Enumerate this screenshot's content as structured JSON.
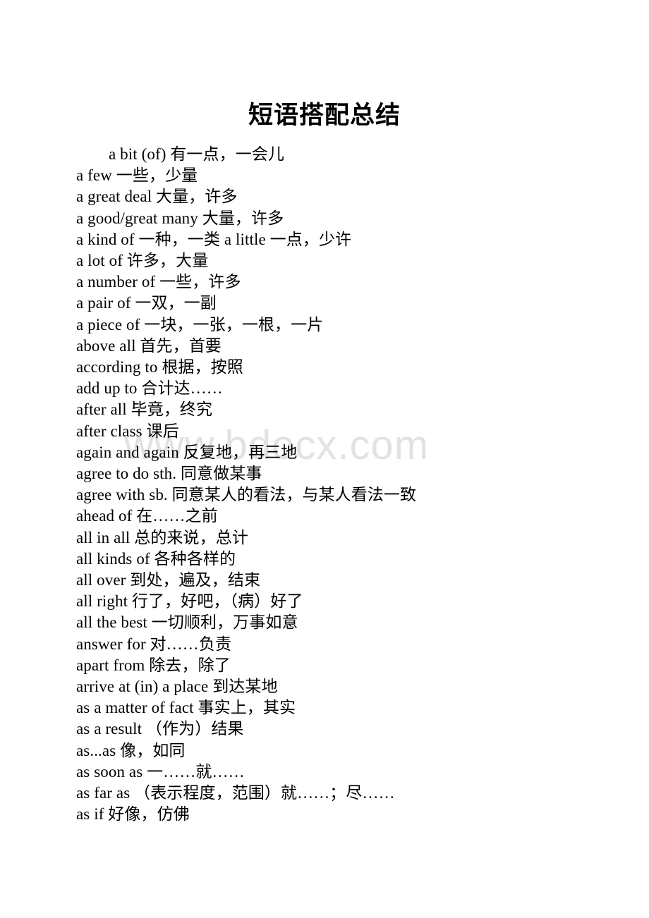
{
  "document": {
    "title": "短语搭配总结",
    "watermark": "www.bdocx.com",
    "lines": [
      {
        "text": "a bit (of) 有一点，一会儿",
        "indented": true
      },
      {
        "text": "a few 一些，少量",
        "indented": false
      },
      {
        "text": "a great deal 大量，许多",
        "indented": false
      },
      {
        "text": "a good/great many 大量，许多",
        "indented": false
      },
      {
        "text": "a kind of 一种，一类 a little 一点，少许",
        "indented": false
      },
      {
        "text": "a lot of 许多，大量",
        "indented": false
      },
      {
        "text": "a number of 一些，许多",
        "indented": false
      },
      {
        "text": "a pair of 一双，一副",
        "indented": false
      },
      {
        "text": "a piece of 一块，一张，一根，一片",
        "indented": false
      },
      {
        "text": "above all 首先，首要",
        "indented": false
      },
      {
        "text": "according to 根据，按照",
        "indented": false
      },
      {
        "text": "add up to 合计达……",
        "indented": false
      },
      {
        "text": "after all 毕竟，终究",
        "indented": false
      },
      {
        "text": "after class 课后",
        "indented": false
      },
      {
        "text": "again and again 反复地，再三地",
        "indented": false
      },
      {
        "text": "agree to do sth. 同意做某事",
        "indented": false
      },
      {
        "text": "agree with sb. 同意某人的看法，与某人看法一致",
        "indented": false
      },
      {
        "text": "ahead of 在……之前",
        "indented": false
      },
      {
        "text": "all in all 总的来说，总计",
        "indented": false
      },
      {
        "text": "all kinds of 各种各样的",
        "indented": false
      },
      {
        "text": "all over 到处，遍及，结束",
        "indented": false
      },
      {
        "text": "all right 行了，好吧，（病）好了",
        "indented": false
      },
      {
        "text": "all the best 一切顺利，万事如意",
        "indented": false
      },
      {
        "text": "answer for 对……负责",
        "indented": false
      },
      {
        "text": "apart from 除去，除了",
        "indented": false
      },
      {
        "text": "arrive at (in) a place 到达某地",
        "indented": false
      },
      {
        "text": "as a matter of fact 事实上，其实",
        "indented": false
      },
      {
        "text": "as a result （作为）结果",
        "indented": false
      },
      {
        "text": "as...as 像，如同",
        "indented": false
      },
      {
        "text": "as soon as 一……就……",
        "indented": false
      },
      {
        "text": "as far as （表示程度，范围）就……；尽……",
        "indented": false
      },
      {
        "text": "as if 好像，仿佛",
        "indented": false
      }
    ]
  }
}
